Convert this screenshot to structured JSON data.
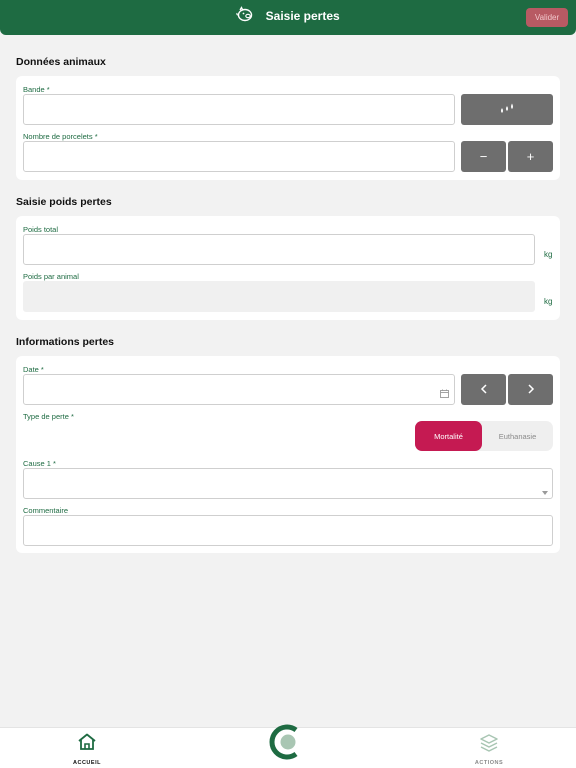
{
  "header": {
    "title": "Saisie pertes",
    "valider_label": "Valider",
    "icon": "pig-icon"
  },
  "section_animaux": {
    "title": "Données animaux",
    "bande_label": "Bande *",
    "bande_value": "",
    "porcelets_label": "Nombre de porcelets *",
    "porcelets_value": "",
    "minus_label": "−",
    "plus_label": "+"
  },
  "section_poids": {
    "title": "Saisie poids pertes",
    "poids_total_label": "Poids total",
    "poids_total_value": "",
    "poids_total_unit": "kg",
    "poids_animal_label": "Poids par animal",
    "poids_animal_value": "",
    "poids_animal_unit": "kg"
  },
  "section_infos": {
    "title": "Informations pertes",
    "date_label": "Date *",
    "date_value": "",
    "type_label": "Type de perte *",
    "type_options": [
      "Mortalité",
      "Euthanasie"
    ],
    "type_selected": "Mortalité",
    "cause_label": "Cause 1 *",
    "cause_value": "",
    "commentaire_label": "Commentaire",
    "commentaire_value": ""
  },
  "footer": {
    "accueil_label": "ACCUEIL",
    "actions_label": "ACTIONS"
  },
  "colors": {
    "primary_green": "#1e6b42",
    "accent_pink": "#c51a52",
    "button_grey": "#6e6e6e"
  }
}
